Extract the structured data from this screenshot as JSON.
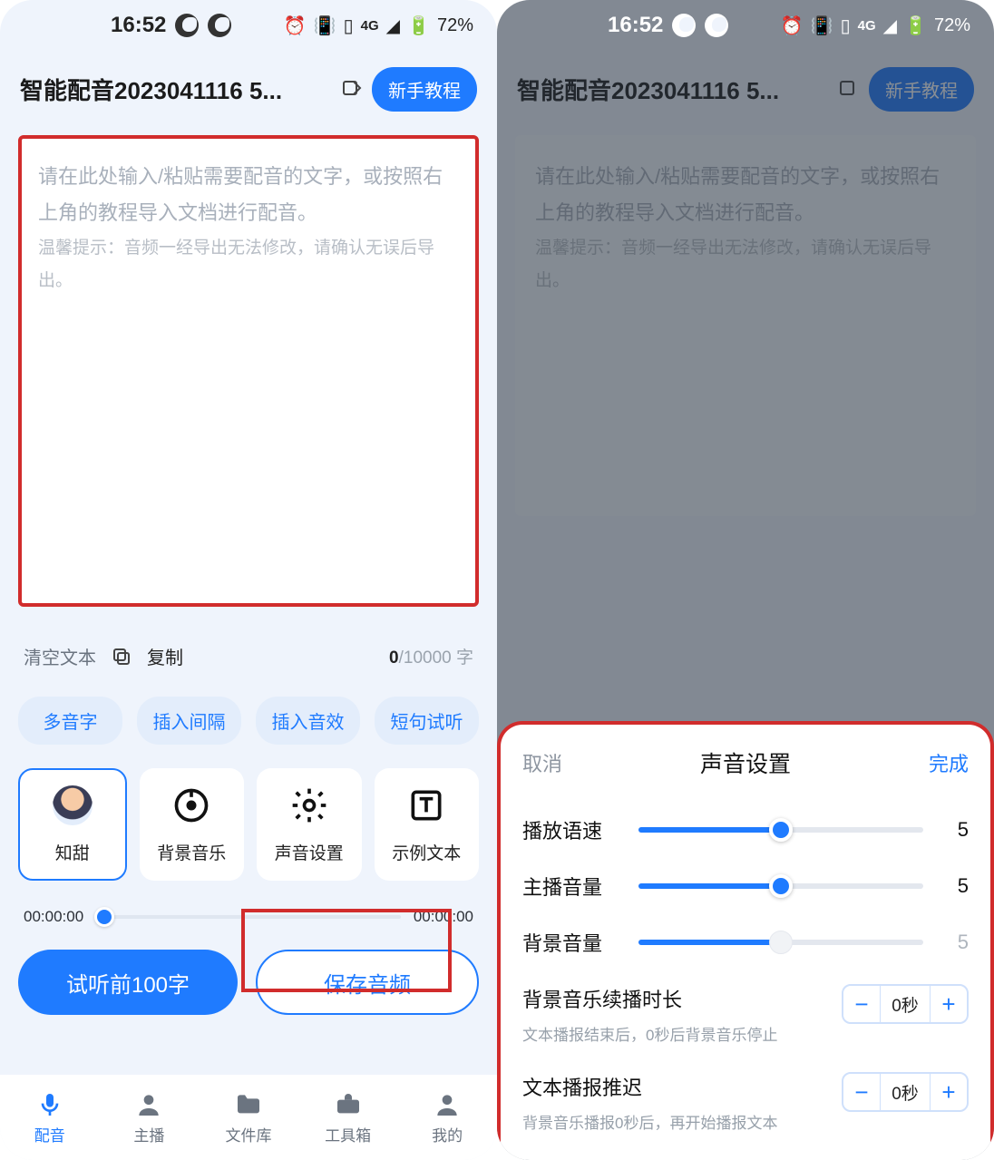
{
  "status": {
    "time": "16:52",
    "network": "4G",
    "battery": "72%"
  },
  "header": {
    "title": "智能配音2023041116 5...",
    "tutorial_btn": "新手教程"
  },
  "textarea": {
    "placeholder_main": "请在此处输入/粘贴需要配音的文字，或按照右上角的教程导入文档进行配音。",
    "placeholder_tip": "温馨提示：音频一经导出无法修改，请确认无误后导出。"
  },
  "row2": {
    "clear": "清空文本",
    "copy": "复制",
    "counter_cur": "0",
    "counter_max": "/10000 字"
  },
  "chips": [
    "多音字",
    "插入间隔",
    "插入音效",
    "短句试听"
  ],
  "cards": [
    {
      "label": "知甜"
    },
    {
      "label": "背景音乐"
    },
    {
      "label": "声音设置"
    },
    {
      "label": "示例文本"
    }
  ],
  "progress": {
    "cur": "00:00:00",
    "total": "00:00:00"
  },
  "buttons": {
    "preview": "试听前100字",
    "save": "保存音频"
  },
  "nav": [
    {
      "label": "配音",
      "active": true
    },
    {
      "label": "主播",
      "active": false
    },
    {
      "label": "文件库",
      "active": false
    },
    {
      "label": "工具箱",
      "active": false
    },
    {
      "label": "我的",
      "active": false
    }
  ],
  "sheet": {
    "cancel": "取消",
    "title": "声音设置",
    "done": "完成",
    "sliders": [
      {
        "label": "播放语速",
        "value": "5",
        "pct": 50,
        "gray": false
      },
      {
        "label": "主播音量",
        "value": "5",
        "pct": 50,
        "gray": false
      },
      {
        "label": "背景音量",
        "value": "5",
        "pct": 50,
        "gray": true
      }
    ],
    "extras": [
      {
        "title": "背景音乐续播时长",
        "sub": "文本播报结束后，0秒后背景音乐停止",
        "val": "0秒"
      },
      {
        "title": "文本播报推迟",
        "sub": "背景音乐播报0秒后，再开始播报文本",
        "val": "0秒"
      }
    ]
  }
}
